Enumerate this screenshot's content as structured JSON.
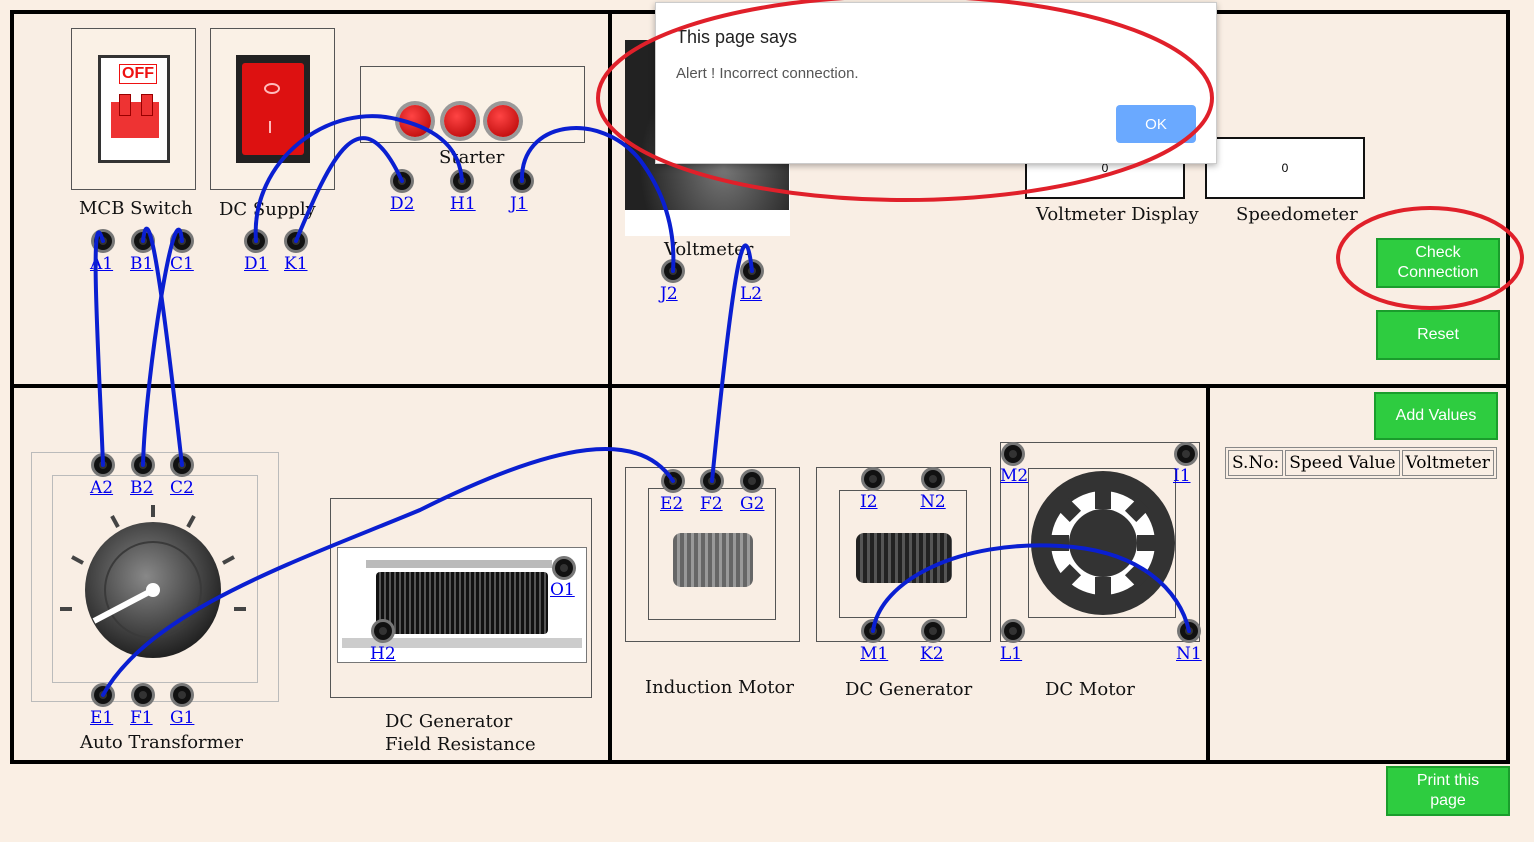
{
  "components": {
    "mcb_switch": {
      "label": "MCB Switch",
      "state_text": "OFF"
    },
    "dc_supply": {
      "label": "DC Supply"
    },
    "starter": {
      "label": "Starter"
    },
    "voltmeter": {
      "label": "Voltmeter"
    },
    "auto_transformer": {
      "label": "Auto Transformer"
    },
    "field_resistance": {
      "label_line1": "DC Generator",
      "label_line2": "Field Resistance"
    },
    "induction_motor": {
      "label": "Induction Motor"
    },
    "dc_generator": {
      "label": "DC Generator"
    },
    "dc_motor": {
      "label": "DC Motor"
    }
  },
  "terminals": {
    "A1": "A1",
    "B1": "B1",
    "C1": "C1",
    "D1": "D1",
    "K1": "K1",
    "D2": "D2",
    "H1": "H1",
    "J1": "J1",
    "J2": "J2",
    "L2": "L2",
    "A2": "A2",
    "B2": "B2",
    "C2": "C2",
    "E1": "E1",
    "F1": "F1",
    "G1": "G1",
    "O1": "O1",
    "H2": "H2",
    "E2": "E2",
    "F2": "F2",
    "G2": "G2",
    "I2": "I2",
    "N2": "N2",
    "M1": "M1",
    "K2": "K2",
    "M2": "M2",
    "I1": "I1",
    "L1": "L1",
    "N1": "N1"
  },
  "displays": {
    "voltmeter_display": {
      "label": "Voltmeter Display",
      "value": "0"
    },
    "speedometer": {
      "label": "Speedometer",
      "value": "0"
    }
  },
  "buttons": {
    "check_connection": "Check Connection",
    "reset": "Reset",
    "add_values": "Add Values",
    "print_page": "Print this page"
  },
  "table": {
    "headers": [
      "S.No:",
      "Speed Value",
      "Voltmeter"
    ]
  },
  "dialog": {
    "title": "This page says",
    "message": "Alert ! Incorrect connection.",
    "ok_label": "OK"
  },
  "colors": {
    "wire": "#0a1fd1",
    "button_green": "#2ecc40",
    "annotation_red": "#e0202a",
    "ok_blue": "#6aa9ff"
  }
}
